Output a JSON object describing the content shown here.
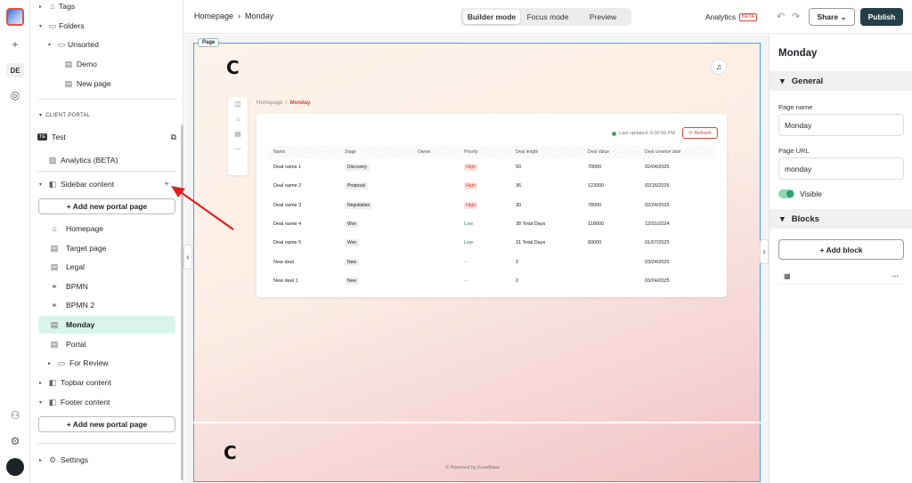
{
  "sidebar": {
    "tags": "Tags",
    "folders": "Folders",
    "unsorted": "Unsorted",
    "demo": "Demo",
    "new_page": "New page",
    "client_portal": "CLIENT PORTAL",
    "test_badge": "TE",
    "test": "Test",
    "analytics": "Analytics (BETA)",
    "sidebar_content": "Sidebar content",
    "add_portal_page": "+ Add new portal page",
    "pages": [
      "Homepage",
      "Target page",
      "Legal",
      "BPMN",
      "BPMN 2",
      "Monday",
      "Portal"
    ],
    "for_review": "For Review",
    "topbar_content": "Topbar content",
    "footer_content": "Footer content",
    "add_portal_page_2": "+ Add new portal page",
    "settings": "Settings"
  },
  "rail": {
    "workspace": "DE"
  },
  "topbar": {
    "breadcrumb_home": "Homepage",
    "breadcrumb_sep": "›",
    "breadcrumb_current": "Monday",
    "modes": [
      "Builder mode",
      "Focus mode",
      "Preview"
    ],
    "analytics": "Analytics",
    "beta": "BETA",
    "share": "Share",
    "share_caret": "⌄",
    "publish": "Publish"
  },
  "canvas": {
    "page_tag": "Page",
    "logo_glyph": "C",
    "crumb_home": "Homepage",
    "crumb_sep": "/",
    "crumb_current": "Monday",
    "last_updated": "Last updated: 6:00:56 PM",
    "refresh": "Refresh",
    "columns": [
      "Name",
      "Stage",
      "Owner",
      "Priority",
      "Deal length",
      "Deal Value",
      "Deal creation date"
    ],
    "rows": [
      {
        "name": "Deal name 1",
        "stage": "Discovery",
        "owner": "",
        "priority": "High",
        "length": "50",
        "value": "70000",
        "date": "02/04/2025"
      },
      {
        "name": "Deal name 2",
        "stage": "Proposal",
        "owner": "",
        "priority": "High",
        "length": "36",
        "value": "122000",
        "date": "02/16/2025"
      },
      {
        "name": "Deal name 3",
        "stage": "Negotiation",
        "owner": "",
        "priority": "High",
        "length": "30",
        "value": "78000",
        "date": "02/24/2025"
      },
      {
        "name": "Deal name 4",
        "stage": "Won",
        "owner": "",
        "priority": "Low",
        "length": "38 Total Days",
        "value": "118000",
        "date": "12/31/2024"
      },
      {
        "name": "Deal name 5",
        "stage": "Won",
        "owner": "",
        "priority": "Low",
        "length": "31 Total Days",
        "value": "89000",
        "date": "01/07/2025"
      },
      {
        "name": "New deal",
        "stage": "New",
        "owner": "",
        "priority": "—",
        "length": "2",
        "value": "",
        "date": "03/24/2025"
      },
      {
        "name": "New deal 1",
        "stage": "New",
        "owner": "",
        "priority": "—",
        "length": "2",
        "value": "",
        "date": "03/24/2025"
      }
    ],
    "powered_by": "© Powered by FuseBase"
  },
  "rpanel": {
    "title": "Monday",
    "general": "General",
    "page_name_label": "Page name",
    "page_name_value": "Monday",
    "page_url_label": "Page URL",
    "page_url_value": "monday",
    "visible": "Visible",
    "blocks": "Blocks",
    "add_block": "+ Add block"
  },
  "colors": {
    "accent": "#234049",
    "selected": "#d9f5ea",
    "highlight_red": "#d6453a",
    "canvas_border": "#4aa0e6"
  }
}
